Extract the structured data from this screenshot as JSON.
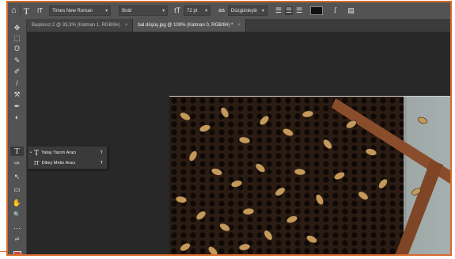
{
  "options_bar": {
    "home_icon": "home-icon",
    "tool_icon": "T",
    "orientation_icon": "IT",
    "font_family": "Times New Roman",
    "font_style": "Bold",
    "size_icon": "tT",
    "font_size": "72 pt",
    "aa_icon": "aa",
    "antialias": "Düzgünleştir",
    "color_swatch": "#000000"
  },
  "tabs": [
    {
      "label": "Başlıksız-2 @ 33,3% (Katman 1, RGB/8#)",
      "close": "×"
    },
    {
      "label": "bal düşüş.jpg @ 100% (Katman 0, RGB/8#) *",
      "close": "×"
    }
  ],
  "toolbar": {
    "tools": [
      "✥",
      "⬚",
      "ʘ",
      "✎",
      "✐",
      "/",
      "⚒",
      "✒",
      "◐",
      "T",
      "✑",
      "↖",
      "▭",
      "✋",
      "🔍",
      "⋯"
    ]
  },
  "flyout": {
    "items": [
      {
        "glyph": "T",
        "label": "Yatay Yazım Aracı",
        "shortcut": "T"
      },
      {
        "glyph": "IT",
        "label": "Dikey Metin Aracı",
        "shortcut": "T"
      }
    ]
  },
  "colors": {
    "accent": "#d9692a",
    "foreground": "#c94a3b"
  }
}
